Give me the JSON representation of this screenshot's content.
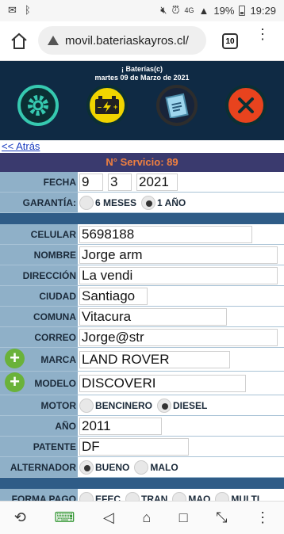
{
  "status_bar": {
    "time": "19:29",
    "battery": "19%",
    "network": "4G"
  },
  "browser": {
    "url": "movil.bateriaskayros.cl/",
    "tab_count": "10"
  },
  "site_header": {
    "title": "¡ Baterías(c)",
    "date": "martes 09 de Marzo de 2021"
  },
  "nav": {
    "back_label": "<< Atrás"
  },
  "service": {
    "label": "N° Servicio: 89"
  },
  "form": {
    "fecha_label": "FECHA",
    "fecha_day": "9",
    "fecha_month": "3",
    "fecha_year": "2021",
    "garantia_label": "GARANTÍA:",
    "garantia_opt1": "6 MESES",
    "garantia_opt2": "1 AÑO",
    "celular_label": "CELULAR",
    "celular_value": "5698188",
    "nombre_label": "NOMBRE",
    "nombre_value": "Jorge arm",
    "direccion_label": "DIRECCIÓN",
    "direccion_value": "La vendi",
    "ciudad_label": "CIUDAD",
    "ciudad_value": "Santiago",
    "comuna_label": "COMUNA",
    "comuna_value": "Vitacura",
    "correo_label": "CORREO",
    "correo_value": "Jorge@str",
    "marca_label": "MARCA",
    "marca_value": "LAND ROVER",
    "modelo_label": "MODELO",
    "modelo_value": "DISCOVERI",
    "motor_label": "MOTOR",
    "motor_opt1": "BENCINERO",
    "motor_opt2": "DIESEL",
    "anio_label": "AÑO",
    "anio_value": "2011",
    "patente_label": "PATENTE",
    "patente_value": "DF",
    "alternador_label": "ALTERNADOR",
    "alternador_opt1": "BUENO",
    "alternador_opt2": "MALO",
    "forma_pago_label": "FORMA PAGO",
    "pago_opt1": "EFEC",
    "pago_opt2": "TRAN",
    "pago_opt3": "MAQ",
    "pago_opt4": "MULTI"
  },
  "colors": {
    "header_bg": "#0f2a44",
    "service_bg": "#3a3a6e",
    "service_text": "#f08040",
    "form_label_bg": "#8fb0c8",
    "separator": "#2f5c87",
    "plus_green": "#6ab23a"
  },
  "icons": {
    "settings": "gear-icon",
    "battery": "battery-icon",
    "clipboard": "clipboard-icon",
    "close": "close-icon"
  }
}
